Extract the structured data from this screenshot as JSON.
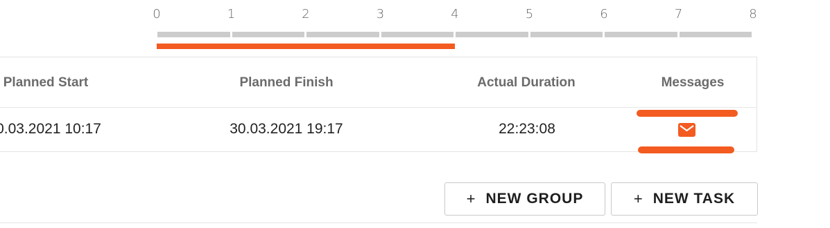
{
  "timeline": {
    "ticks": [
      "0",
      "1",
      "2",
      "3",
      "4",
      "5",
      "6",
      "7",
      "8"
    ],
    "progress": 4,
    "max": 8,
    "progress_color": "#f35b20"
  },
  "table": {
    "headers": {
      "planned_start": "Planned Start",
      "planned_finish": "Planned Finish",
      "actual_duration": "Actual Duration",
      "messages": "Messages"
    },
    "row": {
      "planned_start": "0.03.2021 10:17",
      "planned_finish": "30.03.2021 19:17",
      "actual_duration": "22:23:08",
      "message_icon": "mail-icon"
    }
  },
  "actions": {
    "new_group": "NEW GROUP",
    "new_task": "NEW TASK",
    "plus_icon": "+"
  },
  "colors": {
    "accent": "#f35b20"
  }
}
